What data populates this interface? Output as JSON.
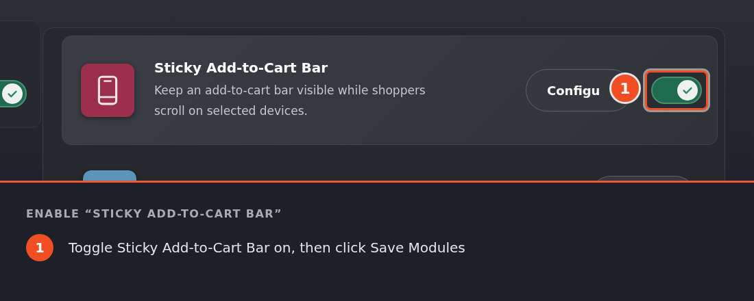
{
  "left_panel": {
    "toggle": {
      "on": true
    }
  },
  "modules": [
    {
      "title": "Sticky Add-to-Cart Bar",
      "description": "Keep an add-to-cart bar visible while shoppers scroll on selected devices.",
      "color": "#9c2f4c",
      "configure_label": "Configu",
      "toggle": {
        "on": true,
        "highlighted": true
      },
      "callout": "1"
    },
    {
      "color": "#5d95b8"
    }
  ],
  "instructions": {
    "heading": "ENABLE “STICKY ADD-TO-CART BAR”",
    "steps": [
      {
        "number": "1",
        "text": "Toggle Sticky Add-to-Cart Bar on, then click Save Modules"
      }
    ]
  }
}
